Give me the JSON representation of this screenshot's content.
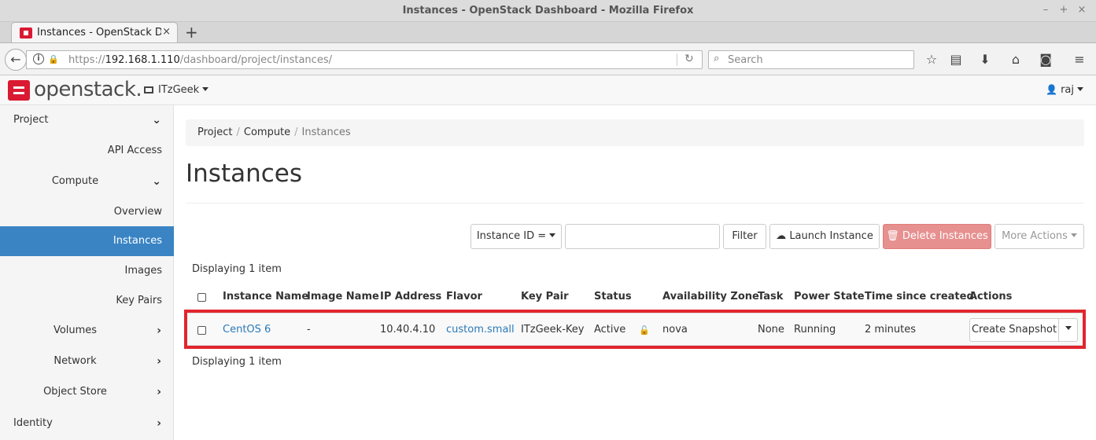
{
  "window": {
    "title": "Instances - OpenStack Dashboard - Mozilla Firefox",
    "controls": [
      "–",
      "+",
      "×"
    ]
  },
  "tabs": [
    {
      "label": "Instances - OpenStack Dashb",
      "close": "×"
    }
  ],
  "new_tab": "+",
  "urlbar": {
    "prefix": "https://",
    "host": "192.168.1.110",
    "path": "/dashboard/project/instances/"
  },
  "searchbar": {
    "placeholder": "Search"
  },
  "brand": {
    "logo_text": "openstack."
  },
  "header": {
    "project": "ITzGeek",
    "user": "raj"
  },
  "sidebar": {
    "items": [
      {
        "label": "Project",
        "level": 0,
        "chevron": "down"
      },
      {
        "label": "API Access",
        "level": 2
      },
      {
        "label": "Compute",
        "level": 1,
        "chevron": "down"
      },
      {
        "label": "Overview",
        "level": 2
      },
      {
        "label": "Instances",
        "level": 2,
        "active": true
      },
      {
        "label": "Images",
        "level": 2
      },
      {
        "label": "Key Pairs",
        "level": 2
      },
      {
        "label": "Volumes",
        "level": 1,
        "chevron": "right"
      },
      {
        "label": "Network",
        "level": 1,
        "chevron": "right"
      },
      {
        "label": "Object Store",
        "level": 1,
        "chevron": "right"
      },
      {
        "label": "Identity",
        "level": 0,
        "chevron": "right"
      }
    ]
  },
  "breadcrumb": {
    "items": [
      "Project",
      "Compute"
    ],
    "current": "Instances",
    "divider": "/"
  },
  "page_title": "Instances",
  "toolbar": {
    "filter_field": "Instance ID =",
    "filter_value": "",
    "filter_button": "Filter",
    "launch_button": "Launch Instance",
    "delete_button": "Delete Instances",
    "more_actions": "More Actions"
  },
  "table": {
    "displaying_top": "Displaying 1 item",
    "displaying_bottom": "Displaying 1 item",
    "columns": [
      "Instance Name",
      "Image Name",
      "IP Address",
      "Flavor",
      "Key Pair",
      "Status",
      "Availability Zone",
      "Task",
      "Power State",
      "Time since created",
      "Actions"
    ],
    "rows": [
      {
        "instance_name": "CentOS 6",
        "image_name": "-",
        "ip_address": "10.40.4.10",
        "flavor": "custom.small",
        "key_pair": "ITzGeek-Key",
        "status": "Active",
        "availability_zone": "nova",
        "task": "None",
        "power_state": "Running",
        "time_since_created": "2 minutes",
        "action": "Create Snapshot"
      }
    ]
  },
  "colors": {
    "brand_red": "#da1a32",
    "active_nav": "#3a84c4",
    "link": "#2a7ab8",
    "danger_button": "#e6908f",
    "highlight_box": "#e0262e"
  }
}
